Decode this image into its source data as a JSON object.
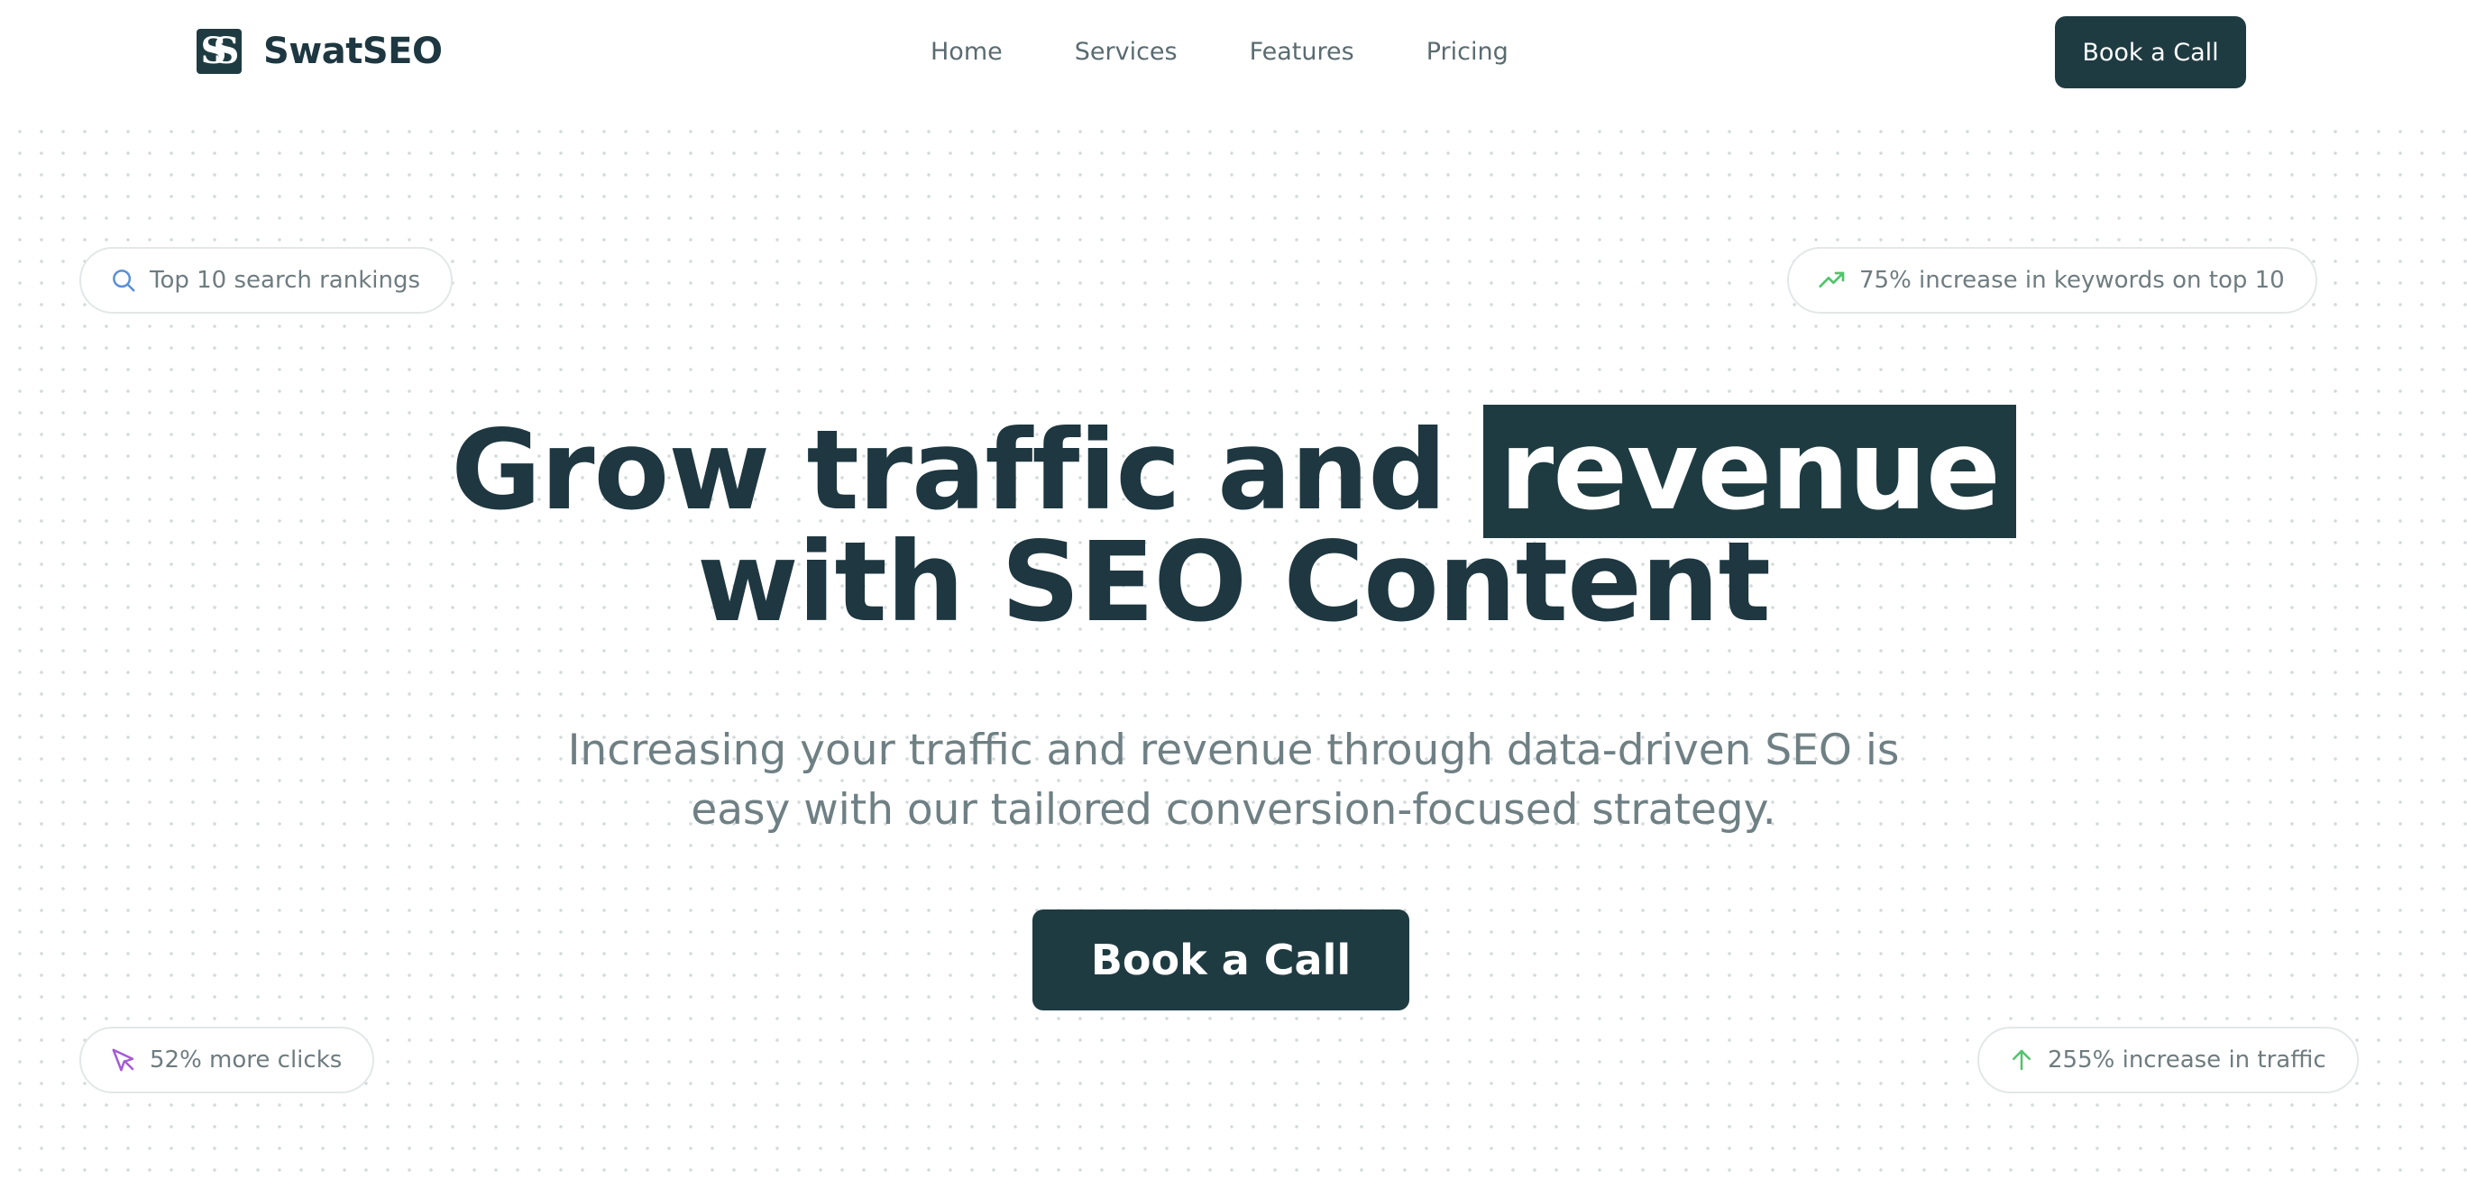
{
  "brand": {
    "name": "SwatSEO",
    "logo_glyph": "SS"
  },
  "nav": {
    "items": [
      {
        "label": "Home"
      },
      {
        "label": "Services"
      },
      {
        "label": "Features"
      },
      {
        "label": "Pricing"
      }
    ]
  },
  "header": {
    "cta_label": "Book a Call"
  },
  "badges": [
    {
      "label": "Top 10 search rankings",
      "icon": "search-icon",
      "color": "#5b8fd6"
    },
    {
      "label": "75% increase in keywords on top 10",
      "icon": "trending-up-icon",
      "color": "#4fc46a"
    },
    {
      "label": "52% more clicks",
      "icon": "cursor-icon",
      "color": "#a45bd6"
    },
    {
      "label": "255% increase in traffic",
      "icon": "arrow-up-icon",
      "color": "#4fc46a"
    }
  ],
  "hero": {
    "title_part1": "Grow traffic and",
    "title_highlight": "revenue",
    "title_line2": "with SEO Content",
    "subtitle_line1": "Increasing your traffic and revenue through data-driven SEO is",
    "subtitle_line2": "easy with our tailored conversion-focused strategy.",
    "cta_label": "Book a Call"
  },
  "colors": {
    "primary": "#1f3b42",
    "text_muted": "#6f8084",
    "pill_border": "#e3e7e8",
    "dot_grid": "#d4dadb"
  }
}
